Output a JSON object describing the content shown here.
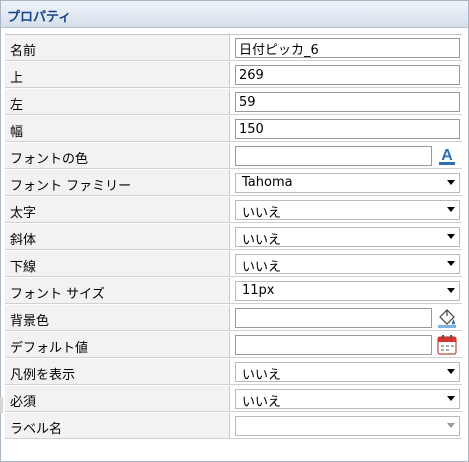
{
  "panel": {
    "title": "プロパティ"
  },
  "properties": {
    "name": {
      "label": "名前",
      "value": "日付ピッカ_6"
    },
    "top": {
      "label": "上",
      "value": "269"
    },
    "left": {
      "label": "左",
      "value": "59"
    },
    "width": {
      "label": "幅",
      "value": "150"
    },
    "font_color": {
      "label": "フォントの色",
      "value": "",
      "icon": "font-color-icon"
    },
    "font_family": {
      "label": "フォント ファミリー",
      "value": "Tahoma"
    },
    "bold": {
      "label": "太字",
      "value": "いいえ"
    },
    "italic": {
      "label": "斜体",
      "value": "いいえ"
    },
    "underline": {
      "label": "下線",
      "value": "いいえ"
    },
    "font_size": {
      "label": "フォント サイズ",
      "value": "11px"
    },
    "background_color": {
      "label": "背景色",
      "value": "",
      "icon": "paint-bucket-icon"
    },
    "default_value": {
      "label": "デフォルト値",
      "value": "",
      "icon": "calendar-icon"
    },
    "show_legend": {
      "label": "凡例を表示",
      "value": "いいえ"
    },
    "required": {
      "label": "必須",
      "value": "いいえ"
    },
    "label_name": {
      "label": "ラベル名",
      "value": ""
    }
  },
  "colors": {
    "header_text": "#15428b",
    "label_bg": "#f2f2f2",
    "font_color_icon": "#2f6fb7",
    "calendar_icon": "#d9342b"
  }
}
